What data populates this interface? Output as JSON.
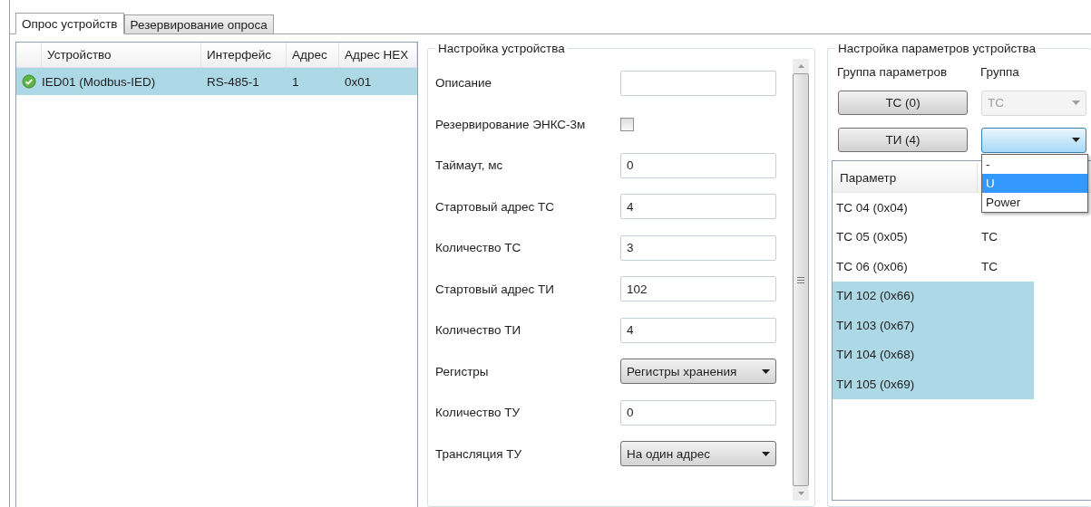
{
  "tabs": [
    {
      "label": "Опрос устройств",
      "selected": true
    },
    {
      "label": "Резервирование опроса",
      "selected": false
    }
  ],
  "devices": {
    "columns": [
      "Устройство",
      "Интерфейс",
      "Адрес",
      "Адрес HEX"
    ],
    "rows": [
      {
        "kind": "ok",
        "selected": true,
        "cells": [
          "IED01 (Modbus-IED)",
          "RS-485-1",
          "1",
          "0x01"
        ]
      }
    ]
  },
  "device_settings": {
    "title": "Настройка устройства",
    "fields": [
      {
        "kind": "text",
        "label": "Описание"
      },
      {
        "kind": "checkbox",
        "label": "Резервирование ЭНКС-3м",
        "checked": false
      },
      {
        "kind": "text",
        "label": "Таймаут, мс",
        "value": "0"
      },
      {
        "kind": "text",
        "label": "Стартовый адрес ТС",
        "value": "4"
      },
      {
        "kind": "text",
        "label": "Количество ТС",
        "value": "3"
      },
      {
        "kind": "text",
        "label": "Стартовый адрес ТИ",
        "value": "102"
      },
      {
        "kind": "text",
        "label": "Количество ТИ",
        "value": "4"
      },
      {
        "kind": "select",
        "label": "Регистры",
        "value": "Регистры хранения"
      },
      {
        "kind": "text",
        "label": "Количество ТУ",
        "value": "0"
      },
      {
        "kind": "select",
        "label": "Трансляция ТУ",
        "value": "На один адрес"
      }
    ]
  },
  "param_settings": {
    "title": "Настройка параметров устройства",
    "headers": [
      "Группа параметров",
      "Группа"
    ],
    "groups": [
      {
        "button": "ТС (0)",
        "group": "ТС",
        "disabled": true,
        "open": false
      },
      {
        "button": "ТИ (4)",
        "disabled": false,
        "open": true,
        "options": [
          {
            "label": "-",
            "selected": false
          },
          {
            "label": "U",
            "selected": true
          },
          {
            "label": "Power",
            "selected": false
          }
        ]
      }
    ],
    "table": {
      "columns": [
        "Параметр"
      ],
      "rows": [
        {
          "name": "ТС 04 (0x04)",
          "selected": false
        },
        {
          "name": "ТС 05 (0x05)",
          "group": "ТС",
          "selected": false
        },
        {
          "name": "ТС 06 (0x06)",
          "group": "ТС",
          "selected": false
        },
        {
          "name": "ТИ 102 (0x66)",
          "selected": true
        },
        {
          "name": "ТИ 103 (0x67)",
          "selected": true
        },
        {
          "name": "ТИ 104 (0x68)",
          "selected": true
        },
        {
          "name": "ТИ 105 (0x69)",
          "selected": true
        }
      ]
    }
  }
}
